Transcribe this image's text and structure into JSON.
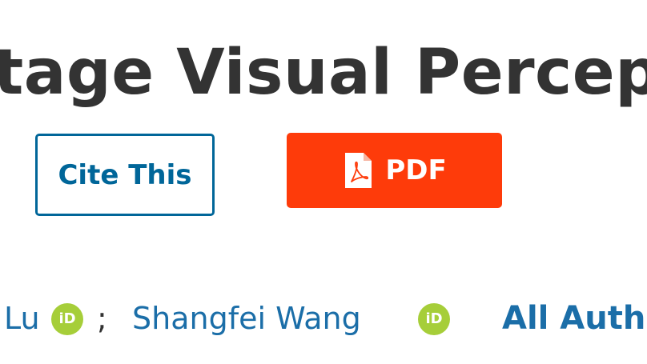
{
  "article": {
    "title": "tage Visual Percept"
  },
  "actions": {
    "cite_label": "Cite This",
    "pdf_label": "PDF"
  },
  "authors": {
    "first_name": "Lu",
    "separator": ";",
    "second_name": "Shangfei Wang",
    "orcid_text": "iD",
    "all_authors_label": "All Auth"
  },
  "icons": {
    "pdf": "pdf-file-icon",
    "orcid": "orcid-icon"
  },
  "colors": {
    "title_text": "#333333",
    "link_blue": "#006699",
    "author_blue": "#1b6ea8",
    "pdf_button_bg": "#fe3b0a",
    "orcid_green": "#a6ce39"
  }
}
